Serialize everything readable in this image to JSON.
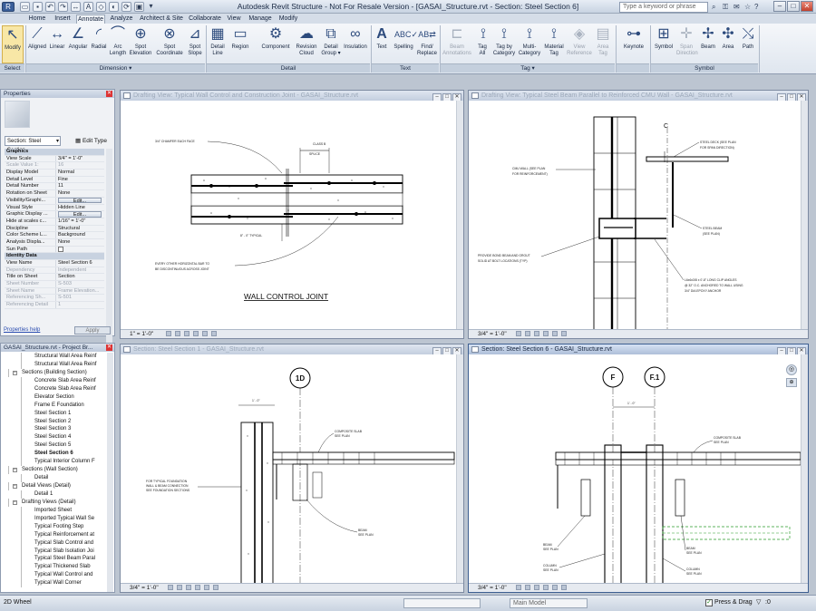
{
  "app": {
    "title": "Autodesk Revit Structure - Not For Resale Version - [GASAI_Structure.rvt - Section: Steel Section 6]",
    "search_placeholder": "Type a keyword or phrase"
  },
  "tabs": [
    "Home",
    "Insert",
    "Annotate",
    "Analyze",
    "Architect & Site",
    "Collaborate",
    "View",
    "Manage",
    "Modify"
  ],
  "ribbon": {
    "modify": "Modify",
    "select_panel": "Select",
    "dimension": [
      "Aligned",
      "Linear",
      "Angular",
      "Radial",
      "Arc\nLength",
      "Spot\nElevation",
      "Spot\nCoordinate",
      "Spot\nSlope"
    ],
    "dimension_panel": "Dimension ▾",
    "detail": [
      "Detail\nLine",
      "Region",
      "Component",
      "Revision\nCloud",
      "Detail\nGroup ▾",
      "Insulation"
    ],
    "detail_panel": "Detail",
    "text": [
      "Text",
      "Spelling",
      "Find/\nReplace"
    ],
    "text_panel": "Text",
    "tag": [
      "Beam\nAnnotations",
      "Tag\nAll",
      "Tag by\nCategory",
      "Multi-\nCategory",
      "Material\nTag",
      "View\nReference",
      "Area\nTag"
    ],
    "tag_panel": "Tag ▾",
    "keynote": "Keynote",
    "symbol": [
      "Symbol",
      "Span\nDirection",
      "Beam",
      "Area",
      "Path"
    ],
    "symbol_panel": "Symbol"
  },
  "properties": {
    "title": "Properties",
    "type": "Section: Steel Section",
    "edit_type": "Edit Type",
    "rows": [
      [
        "c",
        "Graphics",
        ""
      ],
      [
        "n",
        "View Scale",
        "3/4\" = 1'-0\""
      ],
      [
        "r",
        "Scale Value    1:",
        "16"
      ],
      [
        "n",
        "Display Model",
        "Normal"
      ],
      [
        "n",
        "Detail Level",
        "Fine"
      ],
      [
        "n",
        "Detail Number",
        "11"
      ],
      [
        "n",
        "Rotation on Sheet",
        "None"
      ],
      [
        "b",
        "Visibility/Graphi...",
        "Edit..."
      ],
      [
        "n",
        "Visual Style",
        "Hidden Line"
      ],
      [
        "b",
        "Graphic Display ...",
        "Edit..."
      ],
      [
        "n",
        "Hide at scales c...",
        "1/16\" = 1'-0\""
      ],
      [
        "n",
        "Discipline",
        "Structural"
      ],
      [
        "n",
        "Color Scheme L...",
        "Background"
      ],
      [
        "n",
        "Analysis Displa...",
        "None"
      ],
      [
        "k",
        "Sun Path",
        ""
      ],
      [
        "c",
        "Identity Data",
        ""
      ],
      [
        "n",
        "View Name",
        "Steel Section 6"
      ],
      [
        "r",
        "Dependency",
        "Independent"
      ],
      [
        "n",
        "Title on Sheet",
        "Section"
      ],
      [
        "r",
        "Sheet Number",
        "S-503"
      ],
      [
        "r",
        "Sheet Name",
        "Frame Elevation..."
      ],
      [
        "r",
        "Referencing Sh...",
        "S-501"
      ],
      [
        "r",
        "Referencing Detail",
        "1"
      ]
    ],
    "help": "Properties help",
    "apply": "Apply"
  },
  "browser": {
    "title": "GASAI_Structure.rvt - Project Br...",
    "items": [
      [
        3,
        "",
        "Structural Wall Area Reinf"
      ],
      [
        3,
        "",
        "Structural Wall Area Reinf"
      ],
      [
        1,
        "-",
        "Sections (Building Section)"
      ],
      [
        2,
        "",
        "Concrete Slab Area Reinf"
      ],
      [
        2,
        "",
        "Concrete Slab Area Reinf"
      ],
      [
        2,
        "",
        "Elevator Section"
      ],
      [
        2,
        "",
        "Frame E Foundation"
      ],
      [
        2,
        "",
        "Steel Section 1"
      ],
      [
        2,
        "",
        "Steel Section 2"
      ],
      [
        2,
        "",
        "Steel Section 3"
      ],
      [
        2,
        "",
        "Steel Section 4"
      ],
      [
        2,
        "",
        "Steel Section 5"
      ],
      [
        2,
        "b",
        "Steel Section 6"
      ],
      [
        2,
        "",
        "Typical Interior Column F"
      ],
      [
        1,
        "-",
        "Sections (Wall Section)"
      ],
      [
        2,
        "",
        "Detail"
      ],
      [
        1,
        "-",
        "Detail Views (Detail)"
      ],
      [
        2,
        "",
        "Detail 1"
      ],
      [
        1,
        "-",
        "Drafting Views (Detail)"
      ],
      [
        2,
        "",
        "Imported Sheet"
      ],
      [
        2,
        "",
        "Imported Typical Wall Se"
      ],
      [
        2,
        "",
        "Typical Footing Step"
      ],
      [
        2,
        "",
        "Typical Reinforcement at"
      ],
      [
        2,
        "",
        "Typical Slab Control and"
      ],
      [
        2,
        "",
        "Typical Slab Isolation Joi"
      ],
      [
        2,
        "",
        "Typical Steel Beam Paral"
      ],
      [
        2,
        "",
        "Typical Thickened Slab"
      ],
      [
        2,
        "",
        "Typical Wall Control and"
      ],
      [
        2,
        "",
        "Typical Wall Corner"
      ]
    ]
  },
  "views": {
    "v1": {
      "title": "Drafting View: Typical Wall Control and Construction Joint - GASAI_Structure.rvt",
      "scale": "1\" = 1'-0\"",
      "notes": {
        "chamfer": "3/4\" CHAMFER EACH FACE",
        "class": "CLASS B",
        "splice": "SPLICE",
        "typical": "8\" - 0\" TYPICAL",
        "bar1": "EVERY OTHER HORIZONTAL BAR TO",
        "bar2": "BE DISCONTINUOUS ACROSS JOINT",
        "heading": "WALL CONTROL JOINT"
      }
    },
    "v2": {
      "title": "Drafting View: Typical Steel Beam Parallel to Reinforced CMU Wall - GASAI_Structure.rvt",
      "scale": "3/4\" = 1'-0\"",
      "notes": {
        "cl": "C",
        "deck1": "STEEL DECK  (SEE PLAN",
        "deck2": "FOR SPAN DIRECTION)",
        "cmu1": "CMU WALL  (SEE  PLAN",
        "cmu2": "FOR  REINFORCEMENT)",
        "beam1": "STEEL BEAM",
        "beam2": "(SEE PLAN)",
        "bond1": "PROVIDE BOND BEAM AND GROUT",
        "bond2": "SOLID AT BOLT LOCATIONS (TYP)",
        "clip1": "L6x6x3/8 x 0'-8\" LONG CLIP ANGLES",
        "clip2": "@ 32\" O.C. ANCHORED TO WALL USING",
        "clip3": "3/4\" DIA EPOXY ANCHOR"
      }
    },
    "v3": {
      "title": "Section: Steel Section 1 - GASAI_Structure.rvt",
      "scale": "3/4\" = 1'-0\"",
      "grid": "1D",
      "notes": {
        "dim": "1' - 0\"",
        "slab1": "COMPOSITE SLAB",
        "slab2": "SEE PLAN",
        "found1": "FOR TYPICAL FOUNDATION",
        "found2": "WALL & BEAM CONNECTION",
        "found3": "SEE FOUNDATION SECTIONS",
        "beam1": "BEAM",
        "beam2": "SEE PLAN"
      }
    },
    "v4": {
      "title": "Section: Steel Section 6 - GASAI_Structure.rvt",
      "scale": "3/4\" = 1'-0\"",
      "grid_a": "F",
      "grid_b": "F.1",
      "notes": {
        "dim": "1' - 0\"",
        "slab1": "COMPOSITE SLAB",
        "slab2": "SEE PLAN",
        "beam1": "BEAM",
        "beam2": "SEE PLAN",
        "col1": "COLUMN",
        "col2": "SEE PLAN",
        "beam3": "BEAM",
        "beam4": "SEE PLAN",
        "col3": "COLUMN",
        "col4": "SEE PLAN"
      }
    }
  },
  "status": {
    "left": "2D Wheel",
    "model": "Main Model",
    "press_drag": "Press & Drag",
    "zero": ":0"
  }
}
